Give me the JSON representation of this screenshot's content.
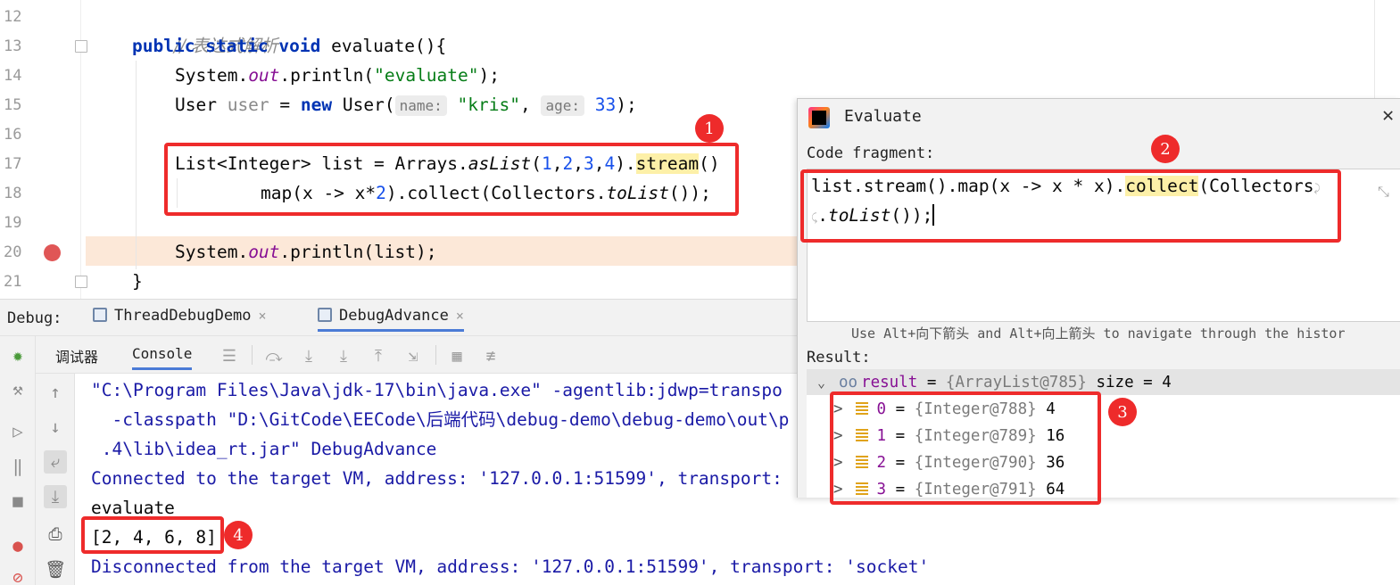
{
  "editor": {
    "line_numbers": [
      "12",
      "13",
      "14",
      "15",
      "16",
      "17",
      "18",
      "19",
      "20",
      "21"
    ],
    "line12": {
      "comment": "// 表达式解析"
    },
    "line13": {
      "kw1": "public",
      "kw2": "static",
      "kw3": "void",
      "rest": "evaluate(){"
    },
    "line14": {
      "a": "System.",
      "field": "out",
      "b": ".println(",
      "str": "\"evaluate\"",
      "c": ");"
    },
    "line15": {
      "type": "User ",
      "var": "user",
      "eq": " = ",
      "kw": "new",
      "ctor": " User(",
      "hint1": "name:",
      "str": "\"kris\"",
      "comma": ",",
      "hint2": "age:",
      "num": "33",
      "end": ");"
    },
    "line17": {
      "a": "List<Integer> list = Arrays.",
      "static": "asList",
      "b": "(",
      "n1": "1",
      "c1": ",",
      "n2": "2",
      "c2": ",",
      "n3": "3",
      "c3": ",",
      "n4": "4",
      "d": ").",
      "hl": "stream",
      "e": "()"
    },
    "line18": {
      "a": "map(x -> x*",
      "num": "2",
      "b": ").collect(Collectors.",
      "static": "toList",
      "c": "());"
    },
    "line20": {
      "a": "System.",
      "field": "out",
      "b": ".println(list);"
    },
    "line21": {
      "a": "}"
    }
  },
  "debug": {
    "label": "Debug:",
    "tabs": [
      {
        "label": "ThreadDebugDemo",
        "close": "×"
      },
      {
        "label": "DebugAdvance",
        "close": "×"
      }
    ],
    "subtabs": {
      "debugger": "调试器",
      "console": "Console"
    },
    "console_lines": [
      "\"C:\\Program Files\\Java\\jdk-17\\bin\\java.exe\" -agentlib:jdwp=transpo",
      "  -classpath \"D:\\GitCode\\EECode\\后端代码\\debug-demo\\debug-demo\\out\\p",
      " .4\\lib\\idea_rt.jar\" DebugAdvance",
      "Connected to the target VM, address: '127.0.0.1:51599', transport:",
      "evaluate",
      "[2, 4, 6, 8]",
      "Disconnected from the target VM, address: '127.0.0.1:51599', transport: 'socket'"
    ]
  },
  "evaluate": {
    "title": "Evaluate",
    "close": "✕",
    "code_label": "Code fragment:",
    "code": {
      "a": "list.stream().map(x -> x * x).",
      "hl": "collect",
      "b": "(Collectors",
      "c": ".",
      "static": "toList",
      "d": "());"
    },
    "hint": "Use Alt+向下箭头 and Alt+向上箭头 to navigate through the histor",
    "result_label": "Result:",
    "root": {
      "name": "result",
      "eq": " = ",
      "value": "{ArrayList@785}",
      "size": "  size = 4"
    },
    "items": [
      {
        "idx": "0",
        "eq": " = ",
        "ref": "{Integer@788}",
        "val": " 4"
      },
      {
        "idx": "1",
        "eq": " = ",
        "ref": "{Integer@789}",
        "val": " 16"
      },
      {
        "idx": "2",
        "eq": " = ",
        "ref": "{Integer@790}",
        "val": " 36"
      },
      {
        "idx": "3",
        "eq": " = ",
        "ref": "{Integer@791}",
        "val": " 64"
      }
    ]
  },
  "annotations": [
    "1",
    "2",
    "3",
    "4"
  ],
  "colors": {
    "annotation": "#ee2b2b",
    "keyword": "#0033b3",
    "string": "#067d17",
    "number": "#1750eb",
    "console": "#1a1aa6"
  }
}
